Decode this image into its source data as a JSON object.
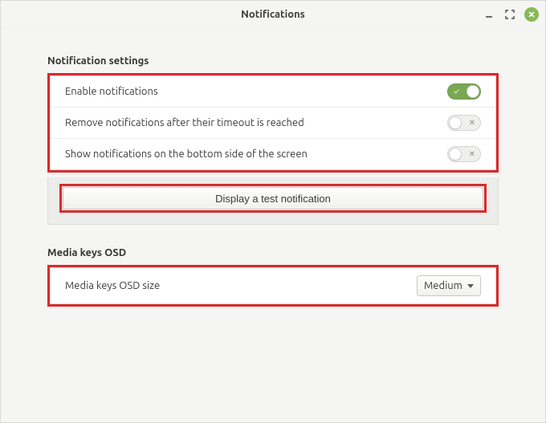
{
  "window": {
    "title": "Notifications"
  },
  "sections": {
    "notifications": {
      "title": "Notification settings",
      "rows": [
        {
          "label": "Enable notifications",
          "enabled": true
        },
        {
          "label": "Remove notifications after their timeout is reached",
          "enabled": false
        },
        {
          "label": "Show notifications on the bottom side of the screen",
          "enabled": false
        }
      ],
      "test_button": "Display a test notification"
    },
    "media": {
      "title": "Media keys OSD",
      "row": {
        "label": "Media keys OSD size",
        "value": "Medium"
      }
    }
  },
  "marks": {
    "on": "✓",
    "off": "✕"
  },
  "colors": {
    "accent_green": "#7aa753",
    "highlight_red": "#d82a2a",
    "close_green": "#89b858"
  }
}
